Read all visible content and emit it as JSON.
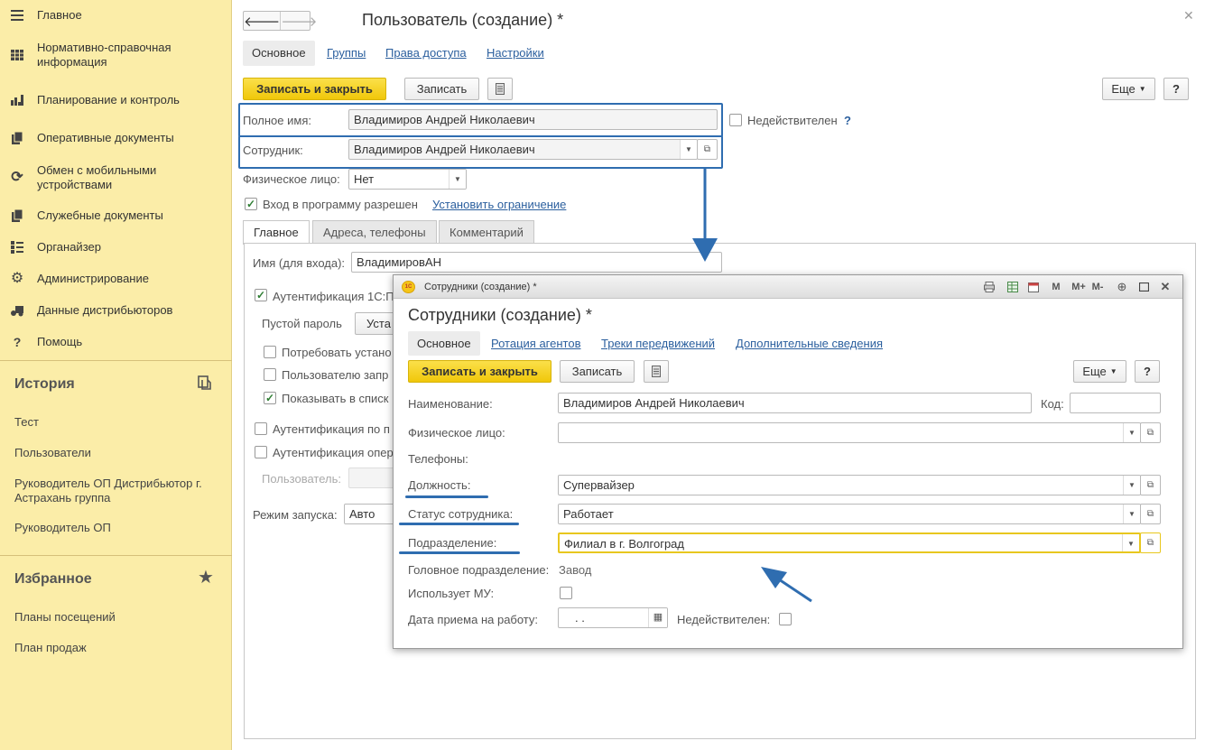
{
  "sidebar": {
    "nav": [
      {
        "label": "Главное",
        "icon": "menu-icon"
      },
      {
        "label": "Нормативно-справочная информация",
        "icon": "grid-icon"
      },
      {
        "label": "Планирование и контроль",
        "icon": "bar-chart-icon"
      },
      {
        "label": "Оперативные документы",
        "icon": "documents-icon"
      },
      {
        "label": "Обмен с мобильными устройствами",
        "icon": "sync-icon"
      },
      {
        "label": "Служебные документы",
        "icon": "documents-icon"
      },
      {
        "label": "Органайзер",
        "icon": "organizer-icon"
      },
      {
        "label": "Администрирование",
        "icon": "gear-icon"
      },
      {
        "label": "Данные дистрибьюторов",
        "icon": "distributor-icon"
      },
      {
        "label": "Помощь",
        "icon": "help-icon"
      }
    ],
    "history": {
      "title": "История",
      "items": [
        "Тест",
        "Пользователи",
        "Руководитель ОП Дистрибьютор г. Астрахань группа",
        "Руководитель ОП"
      ]
    },
    "favorites": {
      "title": "Избранное",
      "items": [
        "Планы посещений",
        "План продаж"
      ]
    }
  },
  "form": {
    "title": "Пользователь (создание) *",
    "tabs": [
      "Основное",
      "Группы",
      "Права доступа",
      "Настройки"
    ],
    "toolbar": {
      "save_close": "Записать и закрыть",
      "save": "Записать",
      "more": "Еще",
      "help": "?"
    },
    "full_name_label": "Полное имя:",
    "full_name_value": "Владимиров Андрей Николаевич",
    "invalid_label": "Недействителен",
    "invalid_help": "?",
    "employee_label": "Сотрудник:",
    "employee_value": "Владимиров Андрей Николаевич",
    "person_label": "Физическое лицо:",
    "person_value": "Нет",
    "login_allowed_label": "Вход в программу разрешен",
    "set_restriction_link": "Установить ограничение",
    "subtabs": [
      "Главное",
      "Адреса, телефоны",
      "Комментарий"
    ],
    "login_name_label": "Имя (для входа):",
    "login_name_value": "ВладимировАН",
    "auth_1c_label": "Аутентификация 1С:П",
    "empty_password_label": "Пустой пароль",
    "set_password_button": "Уста",
    "require_label": "Потребовать устано",
    "user_prohibit_label": "Пользователю запр",
    "show_in_list_label": "Показывать в списк",
    "auth_by_label": "Аутентификация по п",
    "auth_os_label": "Аутентификация опер",
    "os_user_label": "Пользователь:",
    "launch_mode_label": "Режим запуска:",
    "launch_mode_value": "Авто"
  },
  "dialog": {
    "window_title": "Сотрудники (создание) *",
    "title": "Сотрудники (создание) *",
    "logo_text": "1С",
    "tabs": [
      "Основное",
      "Ротация агентов",
      "Треки передвижений",
      "Дополнительные сведения"
    ],
    "toolbar": {
      "save_close": "Записать и закрыть",
      "save": "Записать",
      "more": "Еще",
      "help": "?"
    },
    "window_buttons": [
      "M",
      "M+",
      "M-"
    ],
    "fields": {
      "name_label": "Наименование:",
      "name_value": "Владимиров Андрей Николаевич",
      "code_label": "Код:",
      "code_value": "",
      "person_label": "Физическое лицо:",
      "person_value": "",
      "phones_label": "Телефоны:",
      "position_label": "Должность:",
      "position_value": "Супервайзер",
      "status_label": "Статус сотрудника:",
      "status_value": "Работает",
      "division_label": "Подразделение:",
      "division_value": "Филиал в г. Волгоград",
      "head_division_label": "Головное подразделение:",
      "head_division_value": "Завод",
      "uses_mu_label": "Использует МУ:",
      "hire_date_label": "Дата приема на работу:",
      "hire_date_value": " .  .",
      "invalid_label": "Недействителен:"
    }
  },
  "colors": {
    "sidebar_bg": "#fbeda8",
    "accent_yellow": "#f5c518",
    "annotation_blue": "#2f6db0",
    "link": "#2b5f9e"
  }
}
